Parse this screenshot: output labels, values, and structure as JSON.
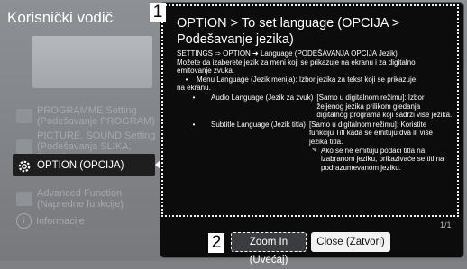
{
  "guide": {
    "title": "Korisnički vodič",
    "menu": [
      {
        "line1": "PROGRAMME Setting",
        "line2": "(Podešavanje PROGRAM)",
        "icon": "antenna-icon"
      },
      {
        "line1": "PICTURE, SOUND Setting",
        "line2": "(Podešavanja SLIKA, ZVUK)",
        "icon": "picture-sound-icon"
      },
      {
        "line1": "OPTION (OPCIJA)",
        "line2": "",
        "icon": "gear-icon",
        "active": true
      },
      {
        "line1": "Advanced Function",
        "line2": "(Napredne funkcije)",
        "icon": "advanced-icon"
      },
      {
        "line1": "Informacije",
        "line2": "",
        "icon": "info-icon"
      }
    ]
  },
  "help": {
    "callout_1": "1",
    "callout_2": "2",
    "heading_line1": "OPTION > To set language (OPCIJA >",
    "heading_line2": "Podešavanje jezika)",
    "intro_line1": "SETTINGS ⇨ OPTION ➜ Language (PODEŠAVANJA   OPCIJA   Jezik)",
    "intro_line2": "Možete da izaberete jezik za meni koji se prikazuje na ekranu i za digitalno",
    "intro_line3": "emitovanje zvuka.",
    "bullet1_line1": "Menu Language (Jezik menija): Izbor jezika za tekst koji se prikazuje",
    "bullet1_line2": "na ekranu.",
    "bullet2_label": "Audio Language (Jezik za zvuk)",
    "bullet2_desc": "[Samo u digitalnom režimu]: Izbor željenog jezika prilikom gledanja digitalnog programa koji sadrži više jezika.",
    "bullet3_label": "Subtitle Language (Jezik titla)",
    "bullet3_desc": "[Samo u digitalnom režimu]: Koristite funkciju Titl kada se emituju dva ili više jezika titla.",
    "note_bullet": "✎",
    "note": "Ako se ne emituju podaci titla na izabranom jeziku, prikazivaće se titl na podrazumevanom jeziku.",
    "page": "1/1"
  },
  "buttons": {
    "zoom": "Zoom In (Uvećaj)",
    "close": "Close (Zatvori)"
  },
  "colors": {
    "panel_bg": "#0c0c0c",
    "menu_bg": "#7e8084",
    "active_item_bg": "#1e1e1e"
  }
}
